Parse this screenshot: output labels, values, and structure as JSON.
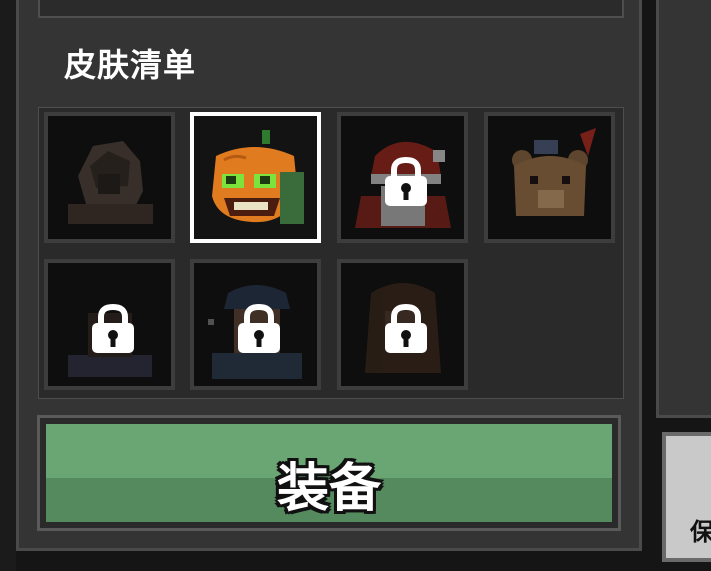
{
  "skin_list": {
    "title": "皮肤清单",
    "skins": [
      {
        "state": "locked-dim",
        "icon": "hooded-knight-icon"
      },
      {
        "state": "selected",
        "icon": "pumpkin-head-icon"
      },
      {
        "state": "locked",
        "icon": "santa-knight-icon"
      },
      {
        "state": "locked-dim",
        "icon": "teddy-bear-icon"
      },
      {
        "state": "locked",
        "icon": "dark-figure-icon"
      },
      {
        "state": "locked",
        "icon": "cap-soldier-icon"
      },
      {
        "state": "locked",
        "icon": "long-hair-icon"
      }
    ]
  },
  "equip_button": {
    "label": "装备"
  },
  "corner_button": {
    "partial_label": "保"
  },
  "colors": {
    "panel": "#343434",
    "button_green": "#6aa574",
    "selected_border": "#ffffff"
  }
}
